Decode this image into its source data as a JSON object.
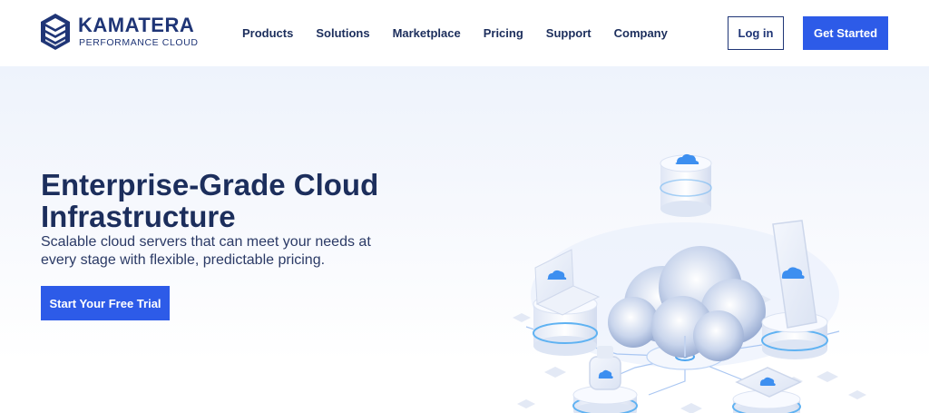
{
  "brand": {
    "name": "KAMATERA",
    "tagline": "PERFORMANCE CLOUD"
  },
  "nav": {
    "items": [
      {
        "label": "Products"
      },
      {
        "label": "Solutions"
      },
      {
        "label": "Marketplace"
      },
      {
        "label": "Pricing"
      },
      {
        "label": "Support"
      },
      {
        "label": "Company"
      }
    ]
  },
  "header": {
    "login_label": "Log in",
    "get_started_label": "Get Started"
  },
  "hero": {
    "title": "Enterprise-Grade Cloud Infrastructure",
    "subtitle": "Scalable cloud servers that can meet your needs at every stage with flexible, predictable pricing.",
    "cta_label": "Start Your Free Trial"
  },
  "colors": {
    "brand_navy": "#1f3576",
    "accent_blue": "#2d5be8",
    "hero_bg": "#eef3fc"
  },
  "icons": {
    "logo": "stacked-hexagon-logo",
    "illustration": "isometric-cloud-network-illustration"
  }
}
